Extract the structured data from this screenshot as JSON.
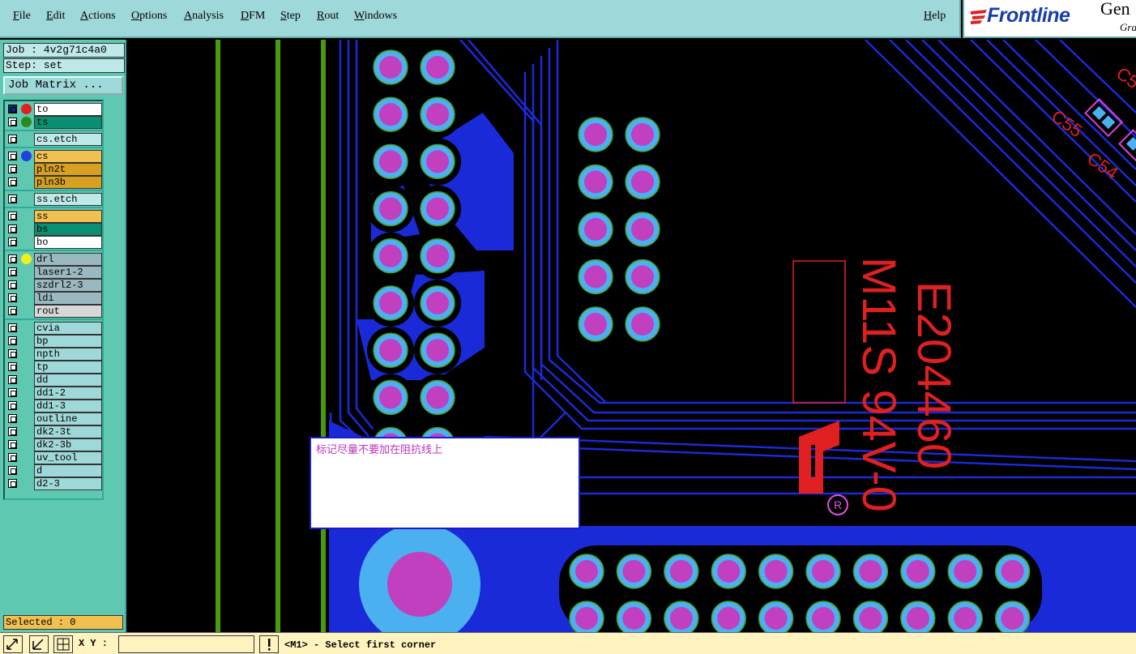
{
  "menu": {
    "file": "File",
    "edit": "Edit",
    "actions": "Actions",
    "options": "Options",
    "analysis": "Analysis",
    "dfm": "DFM",
    "step": "Step",
    "rout": "Rout",
    "windows": "Windows",
    "help": "Help"
  },
  "logo": {
    "brand": "Frontline",
    "product_fragment": "Gen",
    "sub_fragment": "Gra"
  },
  "job": {
    "job_line": "Job : 4v2g71c4a0",
    "step_line": "Step: set",
    "job_matrix": "Job Matrix ..."
  },
  "layers": [
    {
      "name": "to",
      "color": "#ffffff",
      "dot": "#e02020",
      "dark": true
    },
    {
      "name": "ts",
      "color": "#0a9070",
      "dot": "#2a8a20",
      "dark": false
    },
    {
      "name": "cs.etch",
      "color": "#bfe8e8",
      "dot": "",
      "dark": false
    },
    {
      "name": "cs",
      "color": "#f0c050",
      "dot": "#2040e0",
      "dark": false
    },
    {
      "name": "pln2t",
      "color": "#d8a020",
      "dot": "",
      "dark": false
    },
    {
      "name": "pln3b",
      "color": "#d8a020",
      "dot": "",
      "dark": false
    },
    {
      "name": "ss.etch",
      "color": "#bfe8e8",
      "dot": "",
      "dark": false
    },
    {
      "name": "ss",
      "color": "#f0c050",
      "dot": "",
      "dark": false
    },
    {
      "name": "bs",
      "color": "#0a9070",
      "dot": "",
      "dark": false
    },
    {
      "name": "bo",
      "color": "#ffffff",
      "dot": "",
      "dark": false
    },
    {
      "name": "drl",
      "color": "#9ab8c0",
      "dot": "#f0f020",
      "dark": false
    },
    {
      "name": "laser1-2",
      "color": "#9ab8c0",
      "dot": "",
      "dark": false
    },
    {
      "name": "szdrl2-3",
      "color": "#9ab8c0",
      "dot": "",
      "dark": false
    },
    {
      "name": "ldi",
      "color": "#9ab8c0",
      "dot": "",
      "dark": false
    },
    {
      "name": "rout",
      "color": "#d8d8d8",
      "dot": "",
      "dark": false
    },
    {
      "name": "cvia",
      "color": "#9fd8d8",
      "dot": "",
      "dark": false
    },
    {
      "name": "bp",
      "color": "#9fd8d8",
      "dot": "",
      "dark": false
    },
    {
      "name": "npth",
      "color": "#9fd8d8",
      "dot": "",
      "dark": false
    },
    {
      "name": "tp",
      "color": "#9fd8d8",
      "dot": "",
      "dark": false
    },
    {
      "name": "dd",
      "color": "#9fd8d8",
      "dot": "",
      "dark": false
    },
    {
      "name": "dd1-2",
      "color": "#9fd8d8",
      "dot": "",
      "dark": false
    },
    {
      "name": "dd1-3",
      "color": "#9fd8d8",
      "dot": "",
      "dark": false
    },
    {
      "name": "outline",
      "color": "#9fd8d8",
      "dot": "",
      "dark": false
    },
    {
      "name": "dk2-3t",
      "color": "#9fd8d8",
      "dot": "",
      "dark": false
    },
    {
      "name": "dk2-3b",
      "color": "#9fd8d8",
      "dot": "",
      "dark": false
    },
    {
      "name": "uv_tool",
      "color": "#9fd8d8",
      "dot": "",
      "dark": false
    },
    {
      "name": "d",
      "color": "#9fd8d8",
      "dot": "",
      "dark": false
    },
    {
      "name": "d2-3",
      "color": "#9fd8d8",
      "dot": "",
      "dark": false
    }
  ],
  "selected": "Selected : 0",
  "canvas": {
    "silk_1": "E204460",
    "silk_2": "M11S 94V-0",
    "silk_reg": "R",
    "ref_c55": "C55",
    "ref_c54": "C54",
    "ref_c5x": "C5",
    "note": "标记尽量不要加在阻抗线上"
  },
  "status": {
    "xy_label": "X Y :",
    "xy_value": "",
    "message": "<M1> - Select first corner"
  }
}
